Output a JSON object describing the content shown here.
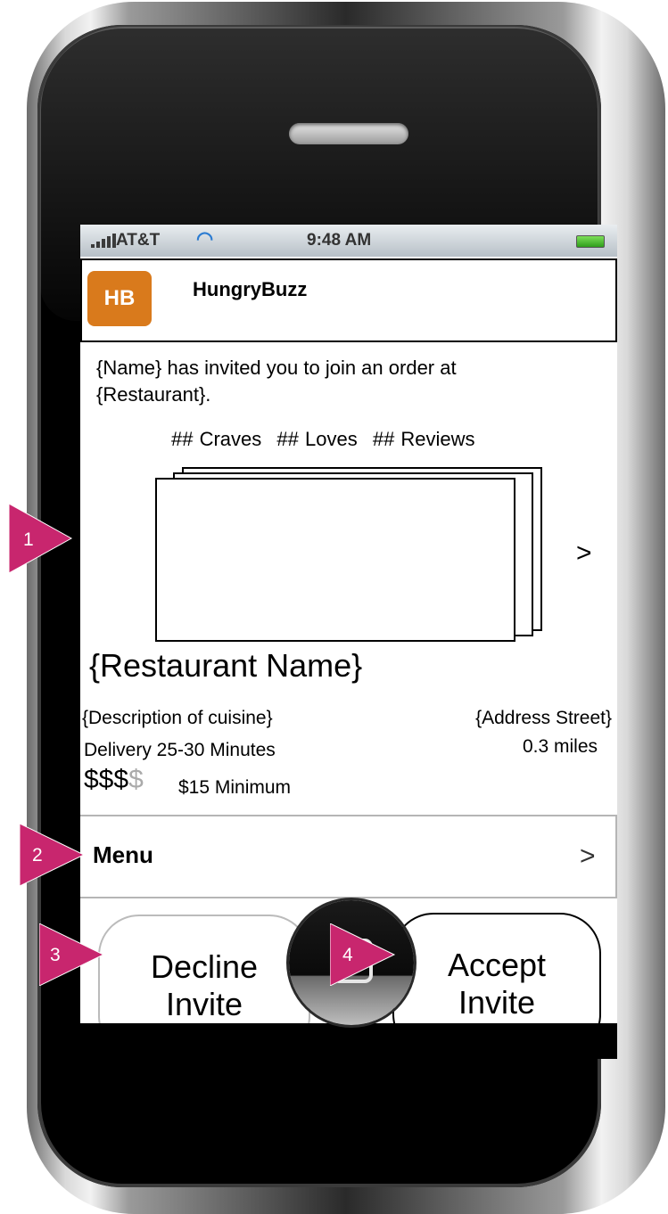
{
  "status_bar": {
    "carrier": "AT&T",
    "time": "9:48 AM"
  },
  "app": {
    "logo_text": "HB",
    "name": "HungryBuzz",
    "brand_color": "#d97a1c"
  },
  "invite": {
    "line1": "{Name} has invited you to join an order at",
    "line2": "{Restaurant}."
  },
  "stats": {
    "craves": "## Craves",
    "loves": "## Loves",
    "reviews": "## Reviews"
  },
  "photos": {
    "next_label": ">"
  },
  "restaurant": {
    "name": "{Restaurant Name}",
    "description": "{Description of cuisine}",
    "address": "{Address Street}",
    "delivery": "Delivery 25-30 Minutes",
    "distance": "0.3 miles",
    "price_active": "$$$",
    "price_inactive": "$",
    "price_level": 3,
    "price_max": 4,
    "minimum": "$15 Minimum"
  },
  "menu": {
    "label": "Menu",
    "chevron": ">"
  },
  "buttons": {
    "decline_line1": "Decline",
    "decline_line2": "Invite",
    "accept_line1": "Accept",
    "accept_line2": "Invite"
  },
  "annotations": {
    "marker1": "1",
    "marker2": "2",
    "marker3": "3",
    "marker4": "4",
    "marker_color": "#c8266e"
  }
}
